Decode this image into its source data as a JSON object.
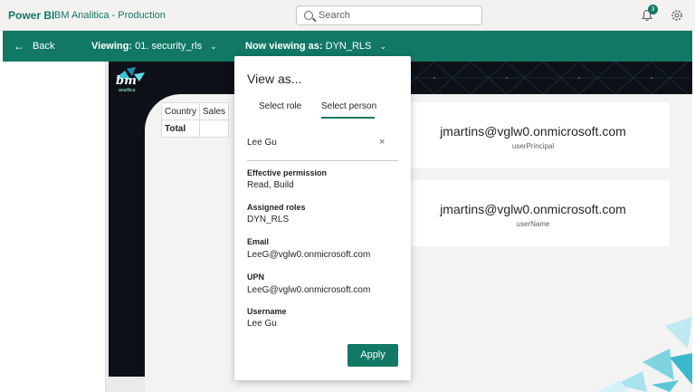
{
  "app": {
    "name": "Power BI",
    "workspace": "BM Analitica - Production"
  },
  "search": {
    "placeholder": "Search"
  },
  "notifications": {
    "count": "3"
  },
  "viewbar": {
    "back": "Back",
    "viewing_label": "Viewing:",
    "viewing_value": "01. security_rls",
    "now_viewing_label": "Now viewing as:",
    "now_viewing_value": "DYN_RLS"
  },
  "report": {
    "logo_text": "bm",
    "logo_sub": "analitica",
    "table": {
      "headers": [
        "Country",
        "Sales"
      ],
      "total_label": "Total"
    },
    "cards": [
      {
        "value": "jmartins@vglw0.onmicrosoft.com",
        "label": "userPrincipal"
      },
      {
        "value": "jmartins@vglw0.onmicrosoft.com",
        "label": "userName"
      }
    ]
  },
  "view_as": {
    "title": "View as...",
    "tabs": [
      "Select role",
      "Select person"
    ],
    "selected_tab": "Select person",
    "person": "Lee Gu",
    "fields": [
      {
        "label": "Effective permission",
        "value": "Read, Build"
      },
      {
        "label": "Assigned roles",
        "value": "DYN_RLS"
      },
      {
        "label": "Email",
        "value": "LeeG@vglw0.onmicrosoft.com"
      },
      {
        "label": "UPN",
        "value": "LeeG@vglw0.onmicrosoft.com"
      },
      {
        "label": "Username",
        "value": "Lee Gu"
      }
    ],
    "apply": "Apply"
  },
  "colors": {
    "accent": "#117865",
    "report_dark": "#0d1117",
    "canvas": "#f3f3f3"
  },
  "icons": [
    "search-icon",
    "bell-icon",
    "gear-icon",
    "back-arrow-icon",
    "chevron-down-icon",
    "close-icon"
  ]
}
